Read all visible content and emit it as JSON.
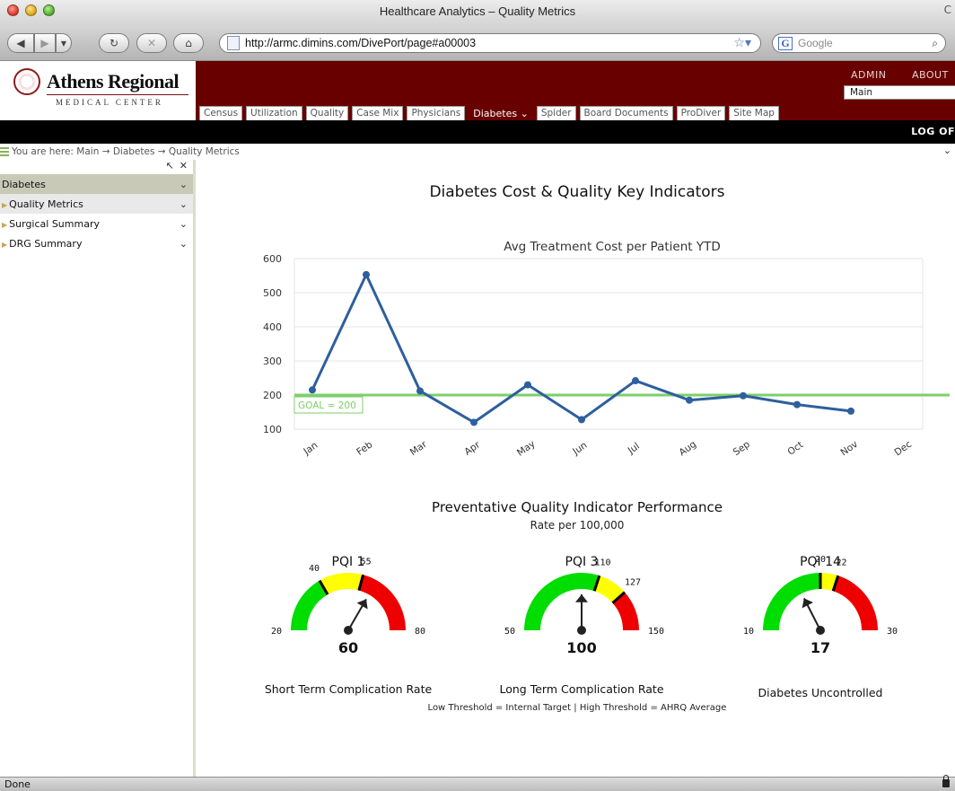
{
  "window": {
    "title": "Healthcare Analytics – Quality Metrics",
    "url": "http://armc.dimins.com/DivePort/page#a00003",
    "search_placeholder": "Google",
    "status": "Done"
  },
  "header": {
    "logo_name": "Athens Regional",
    "logo_sub": "MEDICAL CENTER",
    "admin_link": "ADMIN",
    "about_link": "ABOUT",
    "view_select": "Main",
    "logoff": "LOG OF",
    "tabs": [
      {
        "label": "Census"
      },
      {
        "label": "Utilization"
      },
      {
        "label": "Quality"
      },
      {
        "label": "Case Mix"
      },
      {
        "label": "Physicians"
      },
      {
        "label": "Diabetes ⌄"
      },
      {
        "label": "Spider"
      },
      {
        "label": "Board Documents"
      },
      {
        "label": "ProDiver"
      },
      {
        "label": "Site Map"
      }
    ]
  },
  "breadcrumb": {
    "text": "You are here:  Main → Diabetes → Quality Metrics"
  },
  "sidebar": {
    "header": "Diabetes",
    "items": [
      {
        "label": "Quality Metrics"
      },
      {
        "label": "Surgical Summary"
      },
      {
        "label": "DRG Summary"
      }
    ]
  },
  "main": {
    "heading": "Diabetes Cost & Quality Key Indicators",
    "pqi_title": "Preventative Quality Indicator Performance",
    "pqi_subtitle": "Rate per 100,000",
    "threshold_note": "Low Threshold = Internal Target     | High Threshold = AHRQ Average"
  },
  "chart_data": [
    {
      "type": "line",
      "title": "Avg Treatment Cost per Patient YTD",
      "categories": [
        "Jan",
        "Feb",
        "Mar",
        "Apr",
        "May",
        "Jun",
        "Jul",
        "Aug",
        "Sep",
        "Oct",
        "Nov",
        "Dec"
      ],
      "values": [
        215,
        553,
        212,
        120,
        230,
        128,
        242,
        185,
        198,
        172,
        153,
        null
      ],
      "ylim": [
        100,
        600
      ],
      "yticks": [
        100,
        200,
        300,
        400,
        500,
        600
      ],
      "goal": {
        "value": 200,
        "label": "GOAL = 200"
      },
      "colors": {
        "line": "#2e5f9e",
        "goal": "#7dcf6b"
      },
      "grid": true
    },
    {
      "type": "gauge",
      "title": "PQI 1",
      "label": "Short Term Complication Rate",
      "min": 20,
      "max": 80,
      "low_threshold": 40,
      "high_threshold": 55,
      "value": 60,
      "bands": [
        "#ee0000",
        "#ffff00",
        "#00dd00"
      ]
    },
    {
      "type": "gauge",
      "title": "PQI 3",
      "label": "Long Term Complication Rate",
      "min": 50,
      "max": 150,
      "low_threshold": 110,
      "high_threshold": 127,
      "value": 100,
      "bands": [
        "#ee0000",
        "#ffff00",
        "#00dd00"
      ]
    },
    {
      "type": "gauge",
      "title": "PQI 14",
      "label": "Diabetes Uncontrolled",
      "min": 10,
      "max": 30,
      "low_threshold": 20,
      "high_threshold": 22,
      "value": 17,
      "bands": [
        "#ee0000",
        "#ffff00",
        "#00dd00"
      ]
    }
  ]
}
